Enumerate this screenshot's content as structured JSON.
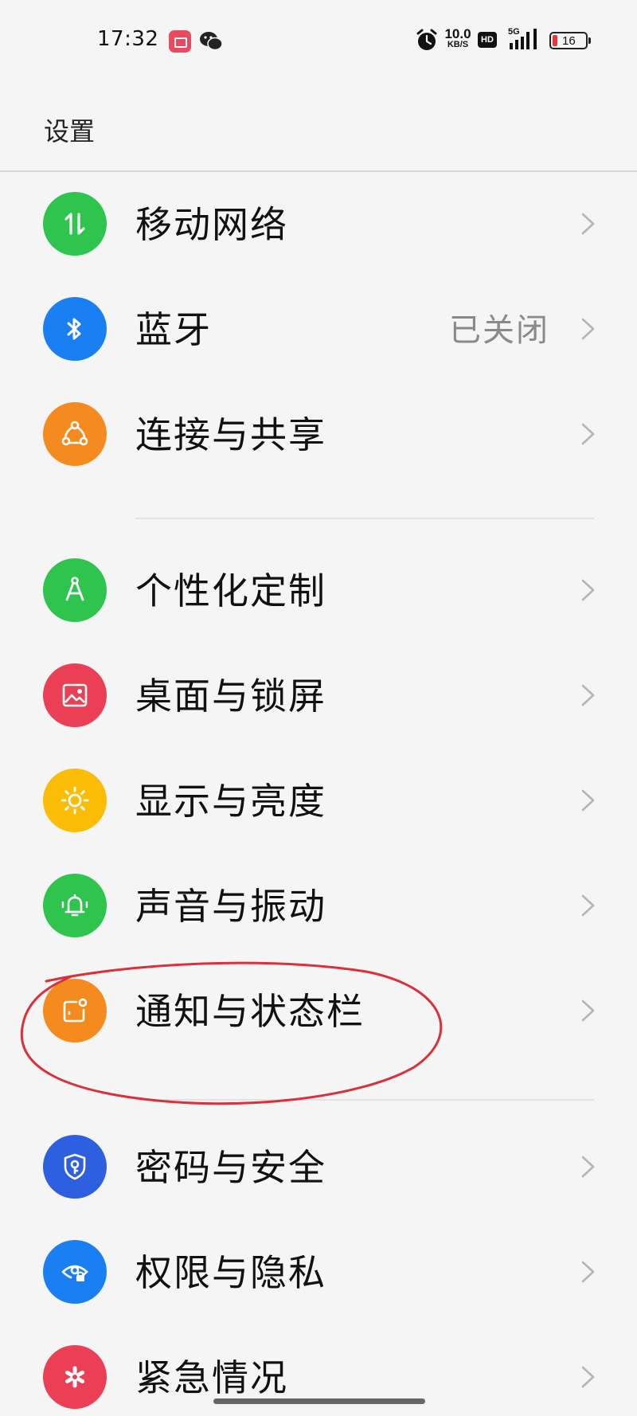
{
  "status_bar": {
    "time": "17:32",
    "net_speed_value": "10.0",
    "net_speed_unit": "KB/S",
    "hd": "HD",
    "network": "5G",
    "battery": "16",
    "battery_level": 0.16
  },
  "header": {
    "title": "设置"
  },
  "colors": {
    "green": "#2ec44e",
    "blue": "#1a7ff2",
    "orange": "#f58a1f",
    "red": "#ea3f55",
    "yellow": "#fbbc05",
    "navy": "#2d5fe0",
    "annotation": "#d9303a"
  },
  "items": [
    {
      "label": "移动网络",
      "value": "",
      "icon": "mobile-data-icon"
    },
    {
      "label": "蓝牙",
      "value": "已关闭",
      "icon": "bluetooth-icon"
    },
    {
      "label": "连接与共享",
      "value": "",
      "icon": "share-connection-icon"
    },
    {
      "label": "个性化定制",
      "value": "",
      "icon": "compass-icon"
    },
    {
      "label": "桌面与锁屏",
      "value": "",
      "icon": "image-icon"
    },
    {
      "label": "显示与亮度",
      "value": "",
      "icon": "brightness-icon"
    },
    {
      "label": "声音与振动",
      "value": "",
      "icon": "bell-vibrate-icon"
    },
    {
      "label": "通知与状态栏",
      "value": "",
      "icon": "notification-icon"
    },
    {
      "label": "密码与安全",
      "value": "",
      "icon": "shield-key-icon"
    },
    {
      "label": "权限与隐私",
      "value": "",
      "icon": "privacy-eye-icon"
    },
    {
      "label": "紧急情况",
      "value": "",
      "icon": "emergency-icon"
    }
  ]
}
